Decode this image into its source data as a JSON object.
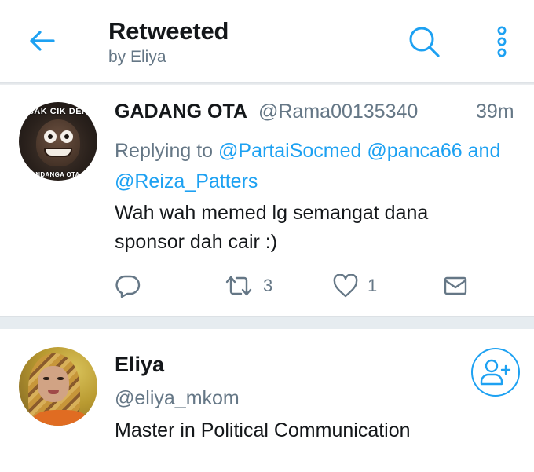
{
  "colors": {
    "accent": "#1da1f2",
    "primary_text": "#14171a",
    "secondary_text": "#657786",
    "divider": "#e6ecf0"
  },
  "header": {
    "title": "Retweeted",
    "subtitle": "by Eliya",
    "back_icon": "arrow-left-icon",
    "search_icon": "search-icon",
    "menu_icon": "overflow-menu-icon"
  },
  "tweet": {
    "avatar_text_top": "SAK CIK DEN",
    "avatar_text_bottom": "MANDANGA OTA AN",
    "name": "GADANG OTA",
    "handle": "@Rama00135340",
    "time": "39m",
    "replying_prefix": "Replying to",
    "mention_1": "@PartaiSocmed",
    "mention_2": "@panca66",
    "and_word": "and",
    "mention_3": "@Reiza_Patters",
    "body_line_1": "Wah wah memed lg semangat dana",
    "body_line_2": "sponsor dah cair :)",
    "actions": {
      "reply_icon": "reply-icon",
      "retweet_icon": "retweet-icon",
      "retweet_count": "3",
      "like_icon": "heart-icon",
      "like_count": "1",
      "dm_icon": "envelope-icon"
    }
  },
  "user": {
    "name": "Eliya",
    "handle": "@eliya_mkom",
    "bio": "Master in Political Communication",
    "follow_icon": "add-user-icon"
  }
}
